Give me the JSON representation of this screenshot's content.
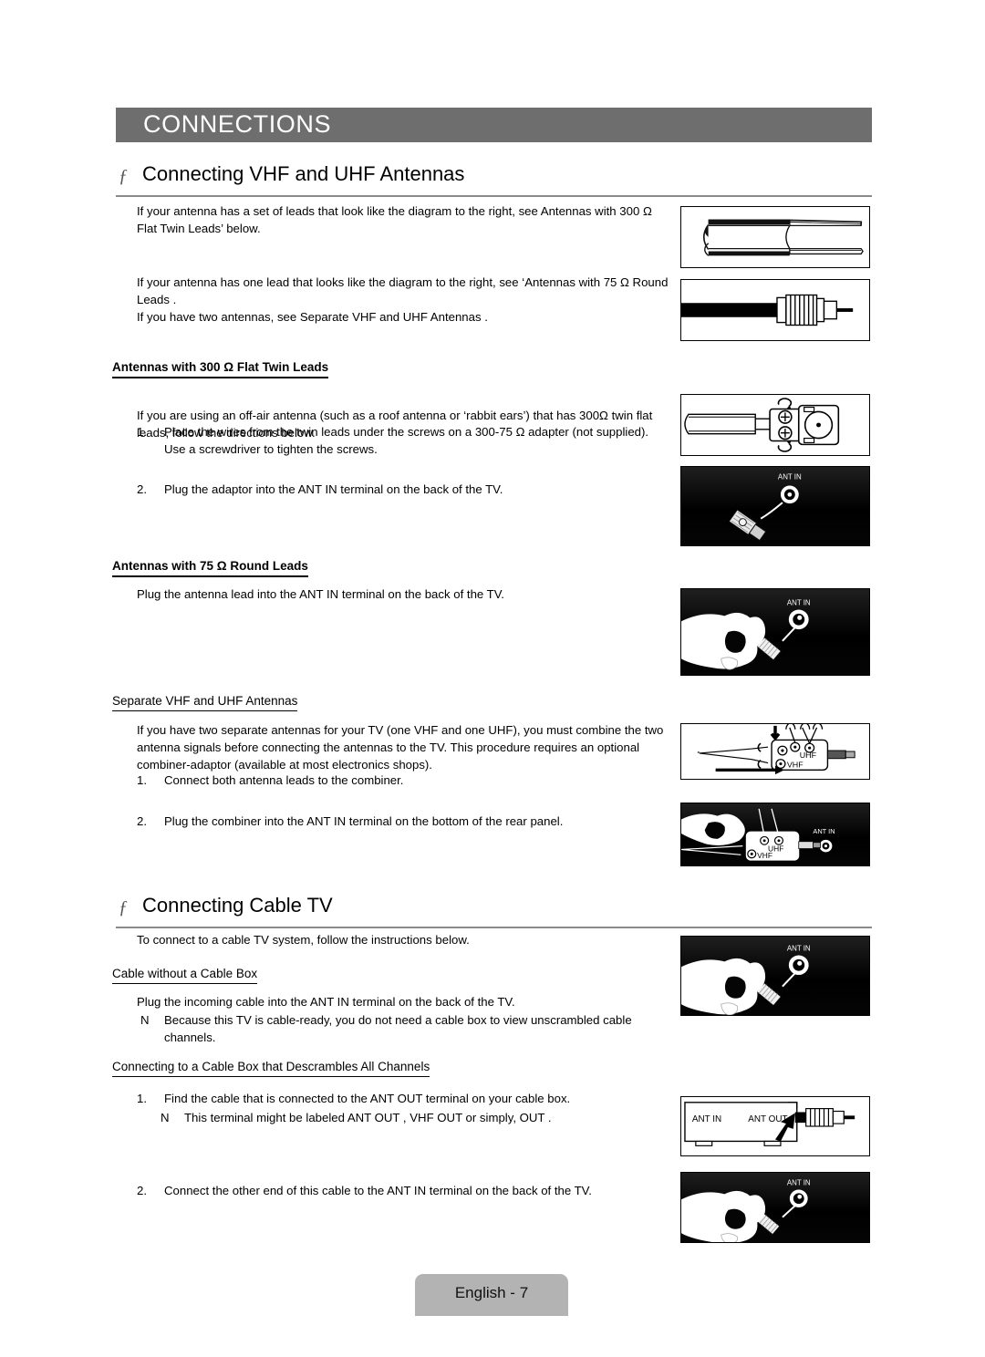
{
  "chapter": {
    "title": "CONNECTIONS",
    "bar_color": "#6e6e6e"
  },
  "sections": [
    {
      "marker": "ƒ",
      "title": "Connecting VHF and UHF Antennas"
    },
    {
      "marker": "ƒ",
      "title": "Connecting Cable TV"
    }
  ],
  "body": {
    "intro_300": "If your antenna has a set of leads that look like the diagram to the right, see  Antennas with 300 Ω Flat Twin Leads’ below.",
    "intro_75": "If your antenna has one lead that looks like the diagram to the right, see ‘Antennas with 75 Ω Round Leads .",
    "intro_two": "If you have two antennas, see  Separate VHF and UHF Antennas .",
    "sub_300_title": "Antennas with 300 Ω Flat Twin Leads",
    "p_300": "If you are using an off-air antenna (such as a roof antenna or ‘rabbit ears’) that has 300Ω twin flat leads, follow the directions below.",
    "step_300_1_marker": "1.",
    "step_300_1": "Place the wires from the twin leads under the screws on a 300-75 Ω adapter (not supplied). Use a screwdriver to tighten the screws.",
    "step_300_2_marker": "2.",
    "step_300_2": "Plug the adaptor into the ANT IN terminal on the back of the TV.",
    "sub_75_title": "Antennas with 75 Ω Round Leads",
    "p_75": "Plug the antenna lead into the ANT IN terminal on the back of the TV.",
    "sub_sep_title": "Separate VHF and UHF Antennas",
    "p_sep": "If you have two separate antennas for your TV (one VHF and one UHF), you must combine the two antenna signals before connecting the antennas to the TV. This procedure requires an optional combiner-adaptor (available at most electronics shops).",
    "step_sep_1_marker": "1.",
    "step_sep_1": "Connect both antenna leads to the combiner.",
    "step_sep_2_marker": "2.",
    "step_sep_2": "Plug the combiner into the ANT IN terminal on the bottom of the rear panel.",
    "p_cabletv": "To connect to a cable TV system, follow the instructions below.",
    "sub_nobox_title": "Cable without a Cable Box",
    "p_nobox": "Plug the incoming cable into the ANT IN terminal on the back of the TV.",
    "note_nobox_marker": "N",
    "note_nobox": "Because this TV is cable-ready, you do not need a cable box to view unscrambled cable channels.",
    "sub_descramble_title": "Connecting to a Cable Box that Descrambles All Channels",
    "step_d1_marker": "1.",
    "step_d1": "Find the cable that is connected to the ANT OUT terminal on your cable box.",
    "note_d1_marker": "N",
    "note_d1": "This terminal might be labeled  ANT OUT ,  VHF OUT  or simply,  OUT .",
    "step_d2_marker": "2.",
    "step_d2": "Connect the other end of this cable to the ANT IN terminal on the back of the TV."
  },
  "figures": {
    "flat_twin_lead": {
      "name": "flat-twin-lead-cable-diagram",
      "style": "line"
    },
    "round_coax_lead": {
      "name": "round-coax-lead-diagram",
      "style": "line"
    },
    "adapter_300_75": {
      "name": "adapter-300-75-ohm-diagram",
      "style": "line"
    },
    "adapter_to_ant_in": {
      "name": "adapter-into-ant-in-photo",
      "style": "dark",
      "label": "ANT IN"
    },
    "hand_coax_ant_in": {
      "name": "hand-coax-into-ant-in-photo",
      "style": "dark",
      "label": "ANT IN"
    },
    "combiner_diagram": {
      "name": "combiner-adaptor-diagram",
      "style": "line",
      "label_uhf": "UHF",
      "label_vhf": "VHF"
    },
    "combiner_ant_in": {
      "name": "combiner-into-ant-in-photo",
      "style": "dark",
      "label": "ANT IN",
      "label_uhf": "UHF",
      "label_vhf": "VHF"
    },
    "cable_no_box": {
      "name": "cable-into-ant-in-photo",
      "style": "dark",
      "label": "ANT IN"
    },
    "cable_box": {
      "name": "cable-box-ant-out-diagram",
      "style": "line",
      "label_in": "ANT IN",
      "label_out": "ANT OUT"
    },
    "cable_box_ant_in": {
      "name": "cable-to-tv-ant-in-photo",
      "style": "dark",
      "label": "ANT IN"
    }
  },
  "footer": {
    "page_label": "English - 7"
  }
}
